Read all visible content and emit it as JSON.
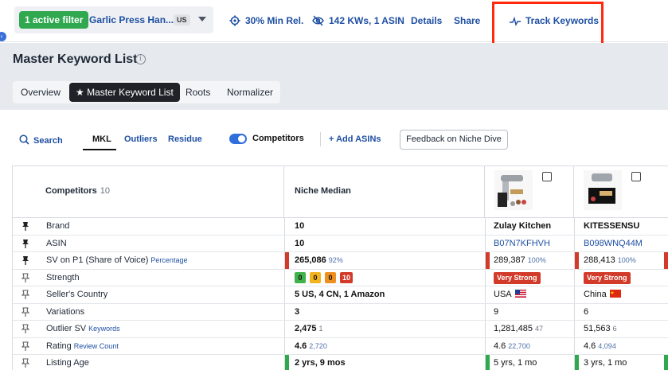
{
  "topbar": {
    "filter_badge": "1 active filter",
    "product_name": "Garlic Press Han...",
    "country": "US",
    "min_rel": "30% Min Rel.",
    "kws": "142 KWs, 1 ASIN",
    "details": "Details",
    "share": "Share",
    "track": "Track Keywords"
  },
  "header": {
    "title": "Master Keyword List",
    "tabs": [
      "Overview",
      "Master Keyword List",
      "Roots",
      "Normalizer"
    ],
    "active_tab": "Master Keyword List"
  },
  "toolbar": {
    "search": "Search",
    "mkl": "MKL",
    "outliers": "Outliers",
    "residue": "Residue",
    "competitors": "Competitors",
    "competitors_on": true,
    "add_asins": "+ Add ASINs",
    "feedback": "Feedback on Niche Dive"
  },
  "table": {
    "competitors_label": "Competitors",
    "competitors_count": "10",
    "median_label": "Niche Median",
    "rows": [
      {
        "label": "Brand",
        "sub": "",
        "pinned": true,
        "median": "10",
        "median_sub": "",
        "c1": "Zulay Kitchen",
        "c1_sub": "",
        "c2": "KITESSENSU",
        "c2_sub": ""
      },
      {
        "label": "ASIN",
        "sub": "",
        "pinned": true,
        "median": "10",
        "median_sub": "",
        "c1": "B07N7KFHVH",
        "c1_sub": "",
        "c2": "B098WNQ44M",
        "c2_sub": ""
      },
      {
        "label": "SV on P1 (Share of Voice)",
        "sub": "Percentage",
        "pinned": true,
        "median": "265,086",
        "median_sub": "92%",
        "c1": "289,387",
        "c1_sub": "100%",
        "c2": "288,413",
        "c2_sub": "100%"
      },
      {
        "label": "Strength",
        "sub": "",
        "pinned": false,
        "median_chips": [
          "0",
          "0",
          "0",
          "10"
        ],
        "c1": "Very Strong",
        "c2": "Very Strong"
      },
      {
        "label": "Seller's Country",
        "sub": "",
        "pinned": false,
        "median": "5 US, 4 CN, 1 Amazon",
        "median_sub": "",
        "c1": "USA",
        "c1_sub": "",
        "c2": "China",
        "c2_sub": ""
      },
      {
        "label": "Variations",
        "sub": "",
        "pinned": false,
        "median": "3",
        "median_sub": "",
        "c1": "9",
        "c1_sub": "",
        "c2": "6",
        "c2_sub": ""
      },
      {
        "label": "Outlier SV",
        "sub": "Keywords",
        "pinned": false,
        "median": "2,475",
        "median_sub": "1",
        "c1": "1,281,485",
        "c1_sub": "47",
        "c2": "51,563",
        "c2_sub": "6"
      },
      {
        "label": "Rating",
        "sub": "Review Count",
        "pinned": false,
        "median": "4.6",
        "median_sub": "2,720",
        "c1": "4.6",
        "c1_sub": "22,700",
        "c2": "4.6",
        "c2_sub": "4,094"
      },
      {
        "label": "Listing Age",
        "sub": "",
        "pinned": false,
        "median": "2 yrs, 9 mos",
        "median_sub": "",
        "c1": "5 yrs, 1 mo",
        "c1_sub": "",
        "c2": "3 yrs, 1 mo",
        "c2_sub": ""
      }
    ]
  },
  "colors": {
    "accent_blue": "#1e4fa3",
    "green": "#2fa84f",
    "red": "#d23a2a",
    "highlight": "#ff2a0e"
  }
}
